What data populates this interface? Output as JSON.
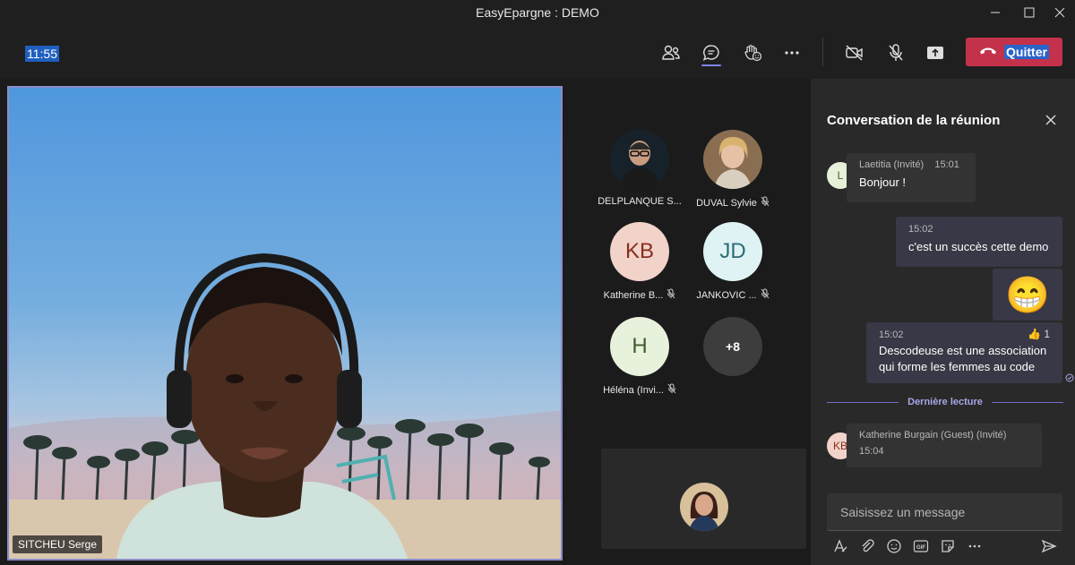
{
  "window": {
    "title": "EasyEpargne : DEMO"
  },
  "toolbar": {
    "clock": "11:55",
    "leave_label": "Quitter",
    "icons": [
      "people-icon",
      "chat-icon",
      "reactions-icon",
      "more-icon",
      "camera-off-icon",
      "mic-off-icon",
      "share-icon",
      "phone-icon"
    ]
  },
  "main_video": {
    "name": "SITCHEU Serge"
  },
  "gallery": [
    {
      "name": "DELPLANQUE S...",
      "muted": false
    },
    {
      "name": "DUVAL Sylvie",
      "muted": true
    },
    {
      "name": "Katherine B...",
      "initials": "KB",
      "muted": true
    },
    {
      "name": "JANKOVIC ...",
      "initials": "JD",
      "muted": true
    },
    {
      "name": "Héléna (Invi...",
      "initials": "H",
      "muted": true
    },
    {
      "more": "+8"
    }
  ],
  "chat": {
    "title": "Conversation de la réunion",
    "messages": [
      {
        "avatar": "L",
        "author": "Laetitia (Invité)",
        "time": "15:01",
        "text": "Bonjour !"
      },
      {
        "time": "15:02",
        "text": "c'est un succès cette demo"
      },
      {
        "emoji": "😁"
      },
      {
        "time": "15:02",
        "text_line1": "Descodeuse est une association",
        "text_line2": "qui forme les femmes au code",
        "reaction": "👍",
        "reaction_count": "1"
      },
      {
        "avatar": "KB",
        "author": "Katherine Burgain (Guest) (Invité)",
        "time": "15:04"
      }
    ],
    "last_read": "Dernière lecture",
    "compose_placeholder": "Saisissez un message"
  },
  "colors": {
    "accent": "#7f85f5",
    "leave": "#c4314b",
    "background": "#1f1f1f",
    "panel": "#292929"
  }
}
